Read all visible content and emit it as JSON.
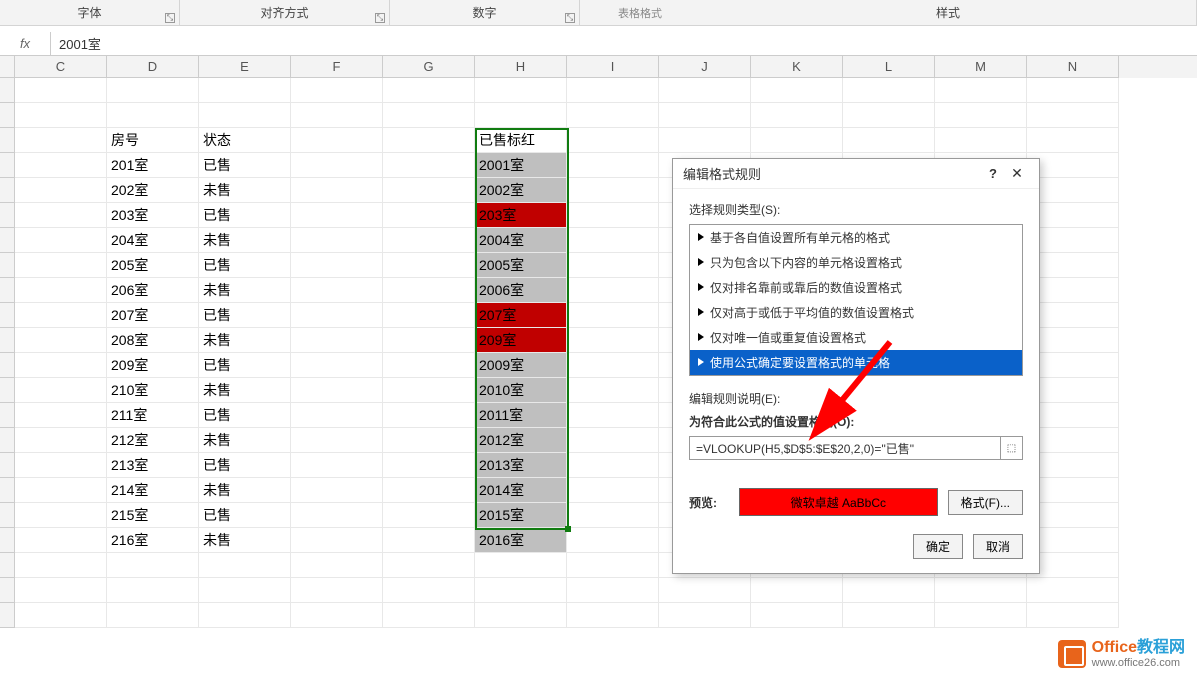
{
  "ribbon": {
    "font": "字体",
    "align": "对齐方式",
    "number": "数字",
    "extra": "表格格式",
    "style": "样式"
  },
  "formula_bar": {
    "fx": "fx",
    "value": "2001室"
  },
  "columns": [
    "C",
    "D",
    "E",
    "F",
    "G",
    "H",
    "I",
    "J",
    "K",
    "L",
    "M",
    "N"
  ],
  "headers": {
    "d": "房号",
    "e": "状态",
    "h": "已售标红"
  },
  "rows": [
    {
      "d": "201室",
      "e": "已售",
      "h": "2001室",
      "hcolor": "gray"
    },
    {
      "d": "202室",
      "e": "未售",
      "h": "2002室",
      "hcolor": "gray"
    },
    {
      "d": "203室",
      "e": "已售",
      "h": "203室",
      "hcolor": "red"
    },
    {
      "d": "204室",
      "e": "未售",
      "h": "2004室",
      "hcolor": "gray"
    },
    {
      "d": "205室",
      "e": "已售",
      "h": "2005室",
      "hcolor": "gray"
    },
    {
      "d": "206室",
      "e": "未售",
      "h": "2006室",
      "hcolor": "gray"
    },
    {
      "d": "207室",
      "e": "已售",
      "h": "207室",
      "hcolor": "red"
    },
    {
      "d": "208室",
      "e": "未售",
      "h": "209室",
      "hcolor": "red"
    },
    {
      "d": "209室",
      "e": "已售",
      "h": "2009室",
      "hcolor": "gray"
    },
    {
      "d": "210室",
      "e": "未售",
      "h": "2010室",
      "hcolor": "gray"
    },
    {
      "d": "211室",
      "e": "已售",
      "h": "2011室",
      "hcolor": "gray"
    },
    {
      "d": "212室",
      "e": "未售",
      "h": "2012室",
      "hcolor": "gray"
    },
    {
      "d": "213室",
      "e": "已售",
      "h": "2013室",
      "hcolor": "gray"
    },
    {
      "d": "214室",
      "e": "未售",
      "h": "2014室",
      "hcolor": "gray"
    },
    {
      "d": "215室",
      "e": "已售",
      "h": "2015室",
      "hcolor": "gray"
    },
    {
      "d": "216室",
      "e": "未售",
      "h": "2016室",
      "hcolor": "gray"
    }
  ],
  "dialog": {
    "title": "编辑格式规则",
    "help": "?",
    "close": "✕",
    "select_label": "选择规则类型(S):",
    "types": [
      "基于各自值设置所有单元格的格式",
      "只为包含以下内容的单元格设置格式",
      "仅对排名靠前或靠后的数值设置格式",
      "仅对高于或低于平均值的数值设置格式",
      "仅对唯一值或重复值设置格式",
      "使用公式确定要设置格式的单元格"
    ],
    "desc_label": "编辑规则说明(E):",
    "formula_label": "为符合此公式的值设置格式(O):",
    "formula": "=VLOOKUP(H5,$D$5:$E$20,2,0)=\"已售\"",
    "preview_label": "预览:",
    "preview_text": "微软卓越 AaBbCc",
    "format_btn": "格式(F)...",
    "ok": "确定",
    "cancel": "取消"
  },
  "watermark": {
    "title_a": "Office",
    "title_b": "教程网",
    "url": "www.office26.com"
  }
}
